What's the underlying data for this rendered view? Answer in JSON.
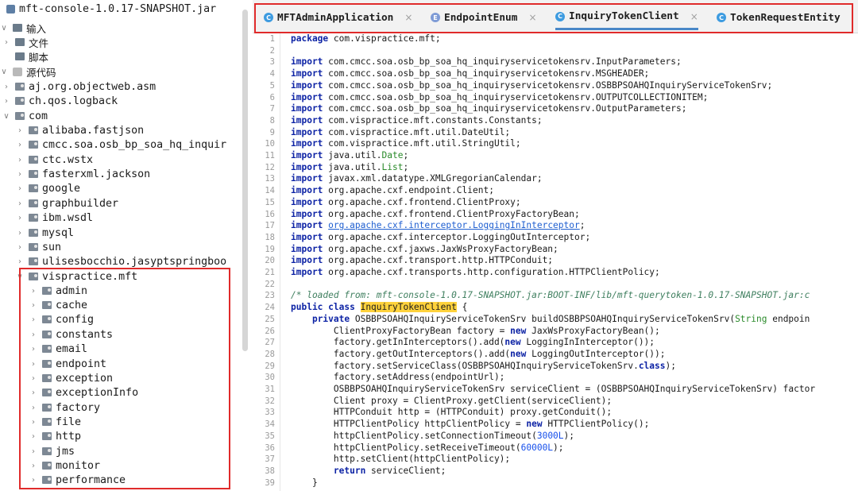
{
  "tree": {
    "items": [
      {
        "label": "mft-console-1.0.17-SNAPSHOT.jar",
        "arrow": "",
        "icon": "jar",
        "depth": 0
      },
      {
        "label": "输入",
        "arrow": "expanded",
        "icon": "input",
        "depth": 0
      },
      {
        "label": "文件",
        "arrow": "collapsed",
        "icon": "input",
        "depth": 1
      },
      {
        "label": "脚本",
        "arrow": "",
        "icon": "input",
        "depth": 1
      },
      {
        "label": "源代码",
        "arrow": "expanded",
        "icon": "src",
        "depth": 0
      },
      {
        "label": "aj.org.objectweb.asm",
        "arrow": "collapsed",
        "icon": "pkg",
        "depth": 1
      },
      {
        "label": "ch.qos.logback",
        "arrow": "collapsed",
        "icon": "pkg",
        "depth": 1
      },
      {
        "label": "com",
        "arrow": "expanded",
        "icon": "pkg",
        "depth": 1
      },
      {
        "label": "alibaba.fastjson",
        "arrow": "collapsed",
        "icon": "pkg",
        "depth": 2
      },
      {
        "label": "cmcc.soa.osb_bp_soa_hq_inquir",
        "arrow": "collapsed",
        "icon": "pkg",
        "depth": 2
      },
      {
        "label": "ctc.wstx",
        "arrow": "collapsed",
        "icon": "pkg",
        "depth": 2
      },
      {
        "label": "fasterxml.jackson",
        "arrow": "collapsed",
        "icon": "pkg",
        "depth": 2
      },
      {
        "label": "google",
        "arrow": "collapsed",
        "icon": "pkg",
        "depth": 2
      },
      {
        "label": "graphbuilder",
        "arrow": "collapsed",
        "icon": "pkg",
        "depth": 2
      },
      {
        "label": "ibm.wsdl",
        "arrow": "collapsed",
        "icon": "pkg",
        "depth": 2
      },
      {
        "label": "mysql",
        "arrow": "collapsed",
        "icon": "pkg",
        "depth": 2
      },
      {
        "label": "sun",
        "arrow": "collapsed",
        "icon": "pkg",
        "depth": 2
      },
      {
        "label": "ulisesbocchio.jasyptspringboo",
        "arrow": "collapsed",
        "icon": "pkg",
        "depth": 2
      },
      {
        "label": "vispractice.mft",
        "arrow": "expanded",
        "icon": "pkg",
        "depth": 2
      },
      {
        "label": "admin",
        "arrow": "collapsed",
        "icon": "pkg",
        "depth": 3
      },
      {
        "label": "cache",
        "arrow": "collapsed",
        "icon": "pkg",
        "depth": 3
      },
      {
        "label": "config",
        "arrow": "collapsed",
        "icon": "pkg",
        "depth": 3
      },
      {
        "label": "constants",
        "arrow": "collapsed",
        "icon": "pkg",
        "depth": 3
      },
      {
        "label": "email",
        "arrow": "collapsed",
        "icon": "pkg",
        "depth": 3
      },
      {
        "label": "endpoint",
        "arrow": "collapsed",
        "icon": "pkg",
        "depth": 3
      },
      {
        "label": "exception",
        "arrow": "collapsed",
        "icon": "pkg",
        "depth": 3
      },
      {
        "label": "exceptionInfo",
        "arrow": "collapsed",
        "icon": "pkg",
        "depth": 3
      },
      {
        "label": "factory",
        "arrow": "collapsed",
        "icon": "pkg",
        "depth": 3
      },
      {
        "label": "file",
        "arrow": "collapsed",
        "icon": "pkg",
        "depth": 3
      },
      {
        "label": "http",
        "arrow": "collapsed",
        "icon": "pkg",
        "depth": 3
      },
      {
        "label": "jms",
        "arrow": "collapsed",
        "icon": "pkg",
        "depth": 3
      },
      {
        "label": "monitor",
        "arrow": "collapsed",
        "icon": "pkg",
        "depth": 3
      },
      {
        "label": "performance",
        "arrow": "collapsed",
        "icon": "pkg",
        "depth": 3
      }
    ]
  },
  "tabs": [
    {
      "label": "MFTAdminApplication",
      "icon": "C",
      "active": false
    },
    {
      "label": "EndpointEnum",
      "icon": "E",
      "active": false
    },
    {
      "label": "InquiryTokenClient",
      "icon": "C",
      "active": true
    },
    {
      "label": "TokenRequestEntity",
      "icon": "C",
      "active": false
    }
  ],
  "code": {
    "line_numbers": [
      "1",
      "2",
      "3",
      "4",
      "5",
      "6",
      "7",
      "8",
      "9",
      "10",
      "11",
      "12",
      "13",
      "14",
      "15",
      "16",
      "17",
      "18",
      "19",
      "20",
      "21",
      "22",
      "23",
      "24",
      "25",
      "26",
      "27",
      "28",
      "29",
      "30",
      "31",
      "32",
      "33",
      "34",
      "35",
      "36",
      "37",
      "38",
      "39"
    ],
    "lines": [
      [
        {
          "t": "package",
          "c": "kw"
        },
        {
          "t": " com.vispractice.mft;",
          "c": ""
        }
      ],
      [],
      [
        {
          "t": "import",
          "c": "kw"
        },
        {
          "t": " com.cmcc.soa.osb_bp_soa_hq_inquiryservicetokensrv.InputParameters;",
          "c": ""
        }
      ],
      [
        {
          "t": "import",
          "c": "kw"
        },
        {
          "t": " com.cmcc.soa.osb_bp_soa_hq_inquiryservicetokensrv.MSGHEADER;",
          "c": ""
        }
      ],
      [
        {
          "t": "import",
          "c": "kw"
        },
        {
          "t": " com.cmcc.soa.osb_bp_soa_hq_inquiryservicetokensrv.OSBBPSOAHQInquiryServiceTokenSrv;",
          "c": ""
        }
      ],
      [
        {
          "t": "import",
          "c": "kw"
        },
        {
          "t": " com.cmcc.soa.osb_bp_soa_hq_inquiryservicetokensrv.OUTPUTCOLLECTIONITEM;",
          "c": ""
        }
      ],
      [
        {
          "t": "import",
          "c": "kw"
        },
        {
          "t": " com.cmcc.soa.osb_bp_soa_hq_inquiryservicetokensrv.OutputParameters;",
          "c": ""
        }
      ],
      [
        {
          "t": "import",
          "c": "kw"
        },
        {
          "t": " com.vispractice.mft.constants.Constants;",
          "c": ""
        }
      ],
      [
        {
          "t": "import",
          "c": "kw"
        },
        {
          "t": " com.vispractice.mft.util.DateUtil;",
          "c": ""
        }
      ],
      [
        {
          "t": "import",
          "c": "kw"
        },
        {
          "t": " com.vispractice.mft.util.StringUtil;",
          "c": ""
        }
      ],
      [
        {
          "t": "import",
          "c": "kw"
        },
        {
          "t": " java.util.",
          "c": ""
        },
        {
          "t": "Date",
          "c": "str"
        },
        {
          "t": ";",
          "c": ""
        }
      ],
      [
        {
          "t": "import",
          "c": "kw"
        },
        {
          "t": " java.util.",
          "c": ""
        },
        {
          "t": "List",
          "c": "str"
        },
        {
          "t": ";",
          "c": ""
        }
      ],
      [
        {
          "t": "import",
          "c": "kw"
        },
        {
          "t": " javax.xml.datatype.XMLGregorianCalendar;",
          "c": ""
        }
      ],
      [
        {
          "t": "import",
          "c": "kw"
        },
        {
          "t": " org.apache.cxf.endpoint.Client;",
          "c": ""
        }
      ],
      [
        {
          "t": "import",
          "c": "kw"
        },
        {
          "t": " org.apache.cxf.frontend.ClientProxy;",
          "c": ""
        }
      ],
      [
        {
          "t": "import",
          "c": "kw"
        },
        {
          "t": " org.apache.cxf.frontend.ClientProxyFactoryBean;",
          "c": ""
        }
      ],
      [
        {
          "t": "import",
          "c": "kw"
        },
        {
          "t": " ",
          "c": ""
        },
        {
          "t": "org.apache.cxf.interceptor.LoggingInInterceptor",
          "c": "lnk"
        },
        {
          "t": ";",
          "c": ""
        }
      ],
      [
        {
          "t": "import",
          "c": "kw"
        },
        {
          "t": " org.apache.cxf.interceptor.LoggingOutInterceptor;",
          "c": ""
        }
      ],
      [
        {
          "t": "import",
          "c": "kw"
        },
        {
          "t": " org.apache.cxf.jaxws.JaxWsProxyFactoryBean;",
          "c": ""
        }
      ],
      [
        {
          "t": "import",
          "c": "kw"
        },
        {
          "t": " org.apache.cxf.transport.http.HTTPConduit;",
          "c": ""
        }
      ],
      [
        {
          "t": "import",
          "c": "kw"
        },
        {
          "t": " org.apache.cxf.transports.http.configuration.HTTPClientPolicy;",
          "c": ""
        }
      ],
      [],
      [
        {
          "t": "/* loaded from: mft-console-1.0.17-SNAPSHOT.jar:BOOT-INF/lib/mft-querytoken-1.0.17-SNAPSHOT.jar:c",
          "c": "cm"
        }
      ],
      [
        {
          "t": "public class",
          "c": "kw"
        },
        {
          "t": " ",
          "c": ""
        },
        {
          "t": "InquiryTokenClient",
          "c": "hl"
        },
        {
          "t": " {",
          "c": ""
        }
      ],
      [
        {
          "t": "    ",
          "c": ""
        },
        {
          "t": "private",
          "c": "kw"
        },
        {
          "t": " OSBBPSOAHQInquiryServiceTokenSrv buildOSBBPSOAHQInquiryServiceTokenSrv(",
          "c": ""
        },
        {
          "t": "String",
          "c": "str"
        },
        {
          "t": " endpoin",
          "c": ""
        }
      ],
      [
        {
          "t": "        ClientProxyFactoryBean factory = ",
          "c": ""
        },
        {
          "t": "new",
          "c": "kw"
        },
        {
          "t": " JaxWsProxyFactoryBean();",
          "c": ""
        }
      ],
      [
        {
          "t": "        factory.getInInterceptors().add(",
          "c": ""
        },
        {
          "t": "new",
          "c": "kw"
        },
        {
          "t": " LoggingInInterceptor());",
          "c": ""
        }
      ],
      [
        {
          "t": "        factory.getOutInterceptors().add(",
          "c": ""
        },
        {
          "t": "new",
          "c": "kw"
        },
        {
          "t": " LoggingOutInterceptor());",
          "c": ""
        }
      ],
      [
        {
          "t": "        factory.setServiceClass(OSBBPSOAHQInquiryServiceTokenSrv.",
          "c": ""
        },
        {
          "t": "class",
          "c": "kw"
        },
        {
          "t": ");",
          "c": ""
        }
      ],
      [
        {
          "t": "        factory.setAddress(endpointUrl);",
          "c": ""
        }
      ],
      [
        {
          "t": "        OSBBPSOAHQInquiryServiceTokenSrv serviceClient = (OSBBPSOAHQInquiryServiceTokenSrv) factor",
          "c": ""
        }
      ],
      [
        {
          "t": "        Client proxy = ClientProxy.getClient(serviceClient);",
          "c": ""
        }
      ],
      [
        {
          "t": "        HTTPConduit http = (HTTPConduit) proxy.getConduit();",
          "c": ""
        }
      ],
      [
        {
          "t": "        HTTPClientPolicy httpClientPolicy = ",
          "c": ""
        },
        {
          "t": "new",
          "c": "kw"
        },
        {
          "t": " HTTPClientPolicy();",
          "c": ""
        }
      ],
      [
        {
          "t": "        httpClientPolicy.setConnectionTimeout(",
          "c": ""
        },
        {
          "t": "3000L",
          "c": "lit-num"
        },
        {
          "t": ");",
          "c": ""
        }
      ],
      [
        {
          "t": "        httpClientPolicy.setReceiveTimeout(",
          "c": ""
        },
        {
          "t": "60000L",
          "c": "lit-num"
        },
        {
          "t": ");",
          "c": ""
        }
      ],
      [
        {
          "t": "        http.setClient(httpClientPolicy);",
          "c": ""
        }
      ],
      [
        {
          "t": "        ",
          "c": ""
        },
        {
          "t": "return",
          "c": "kw"
        },
        {
          "t": " serviceClient;",
          "c": ""
        }
      ],
      [
        {
          "t": "    }",
          "c": ""
        }
      ]
    ]
  },
  "colors": {
    "highlight_border": "#e02b2b",
    "keyword": "#0d23a5",
    "active_tab_underline": "#4a88c7",
    "selection_highlight": "#ffd23c"
  }
}
